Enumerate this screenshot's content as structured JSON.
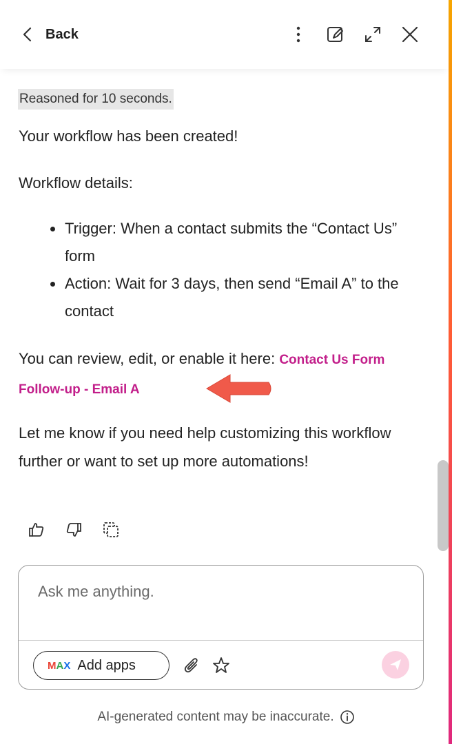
{
  "header": {
    "back_label": "Back",
    "icons": [
      "more-vertical-icon",
      "edit-note-icon",
      "expand-icon",
      "close-icon"
    ]
  },
  "message": {
    "reasoned_badge": "Reasoned for 10 seconds.",
    "title": "Your workflow has been created!",
    "details_heading": "Workflow details:",
    "bullets": [
      "Trigger: When a contact submits the “Contact Us” form",
      "Action: Wait for 3 days, then send “Email A” to the contact"
    ],
    "review_text": "You can review, edit, or enable it here: ",
    "workflow_link": "Contact Us Form Follow-up - Email A",
    "closing": "Let me know if you need help customizing this workflow further or want to set up more automations!"
  },
  "feedback": {
    "icons": [
      "thumbs-up-icon",
      "thumbs-down-icon",
      "copy-icon"
    ]
  },
  "composer": {
    "placeholder": "Ask me anything.",
    "value": "",
    "add_apps_label": "Add apps",
    "logo_letters": [
      "M",
      "A",
      "X"
    ]
  },
  "footer": {
    "disclaimer": "AI-generated content may be inaccurate."
  },
  "colors": {
    "link": "#c21e8a",
    "arrow": "#f05a4a",
    "send_button": "#fbd1e1",
    "badge_bg": "#e6e6e6"
  }
}
